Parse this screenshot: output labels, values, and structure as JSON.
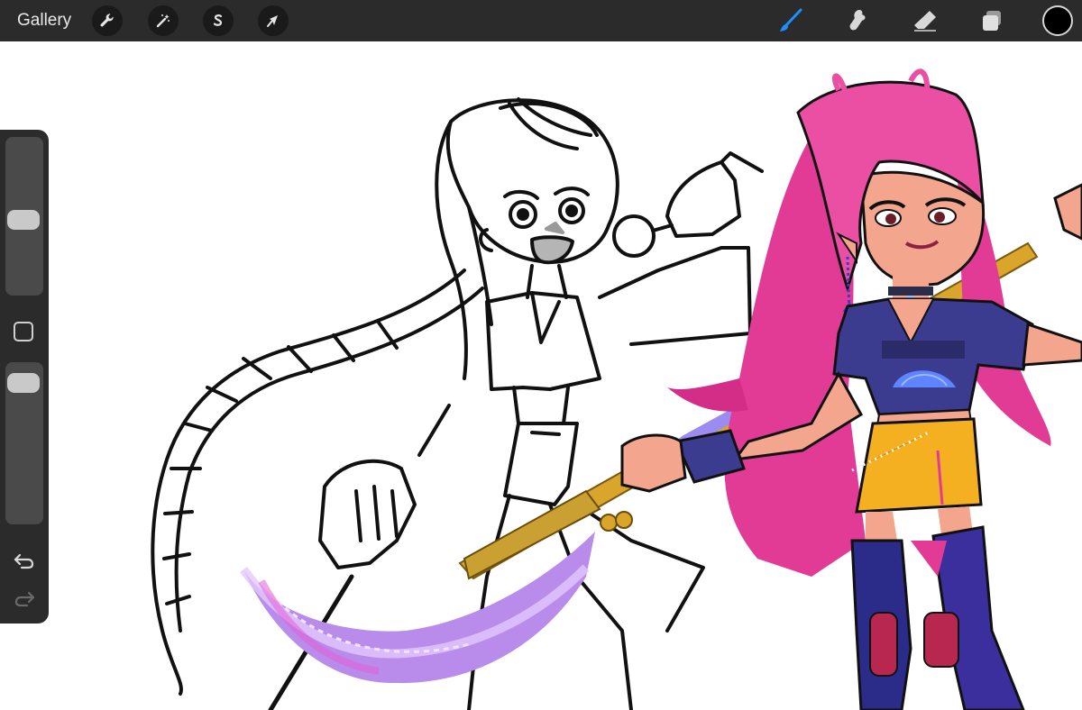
{
  "topbar": {
    "gallery_label": "Gallery",
    "left_tools": [
      "wrench-icon",
      "magic-wand-icon",
      "selection-icon",
      "transform-arrow-icon"
    ],
    "right_tools": [
      "brush-icon",
      "smudge-icon",
      "eraser-icon",
      "layers-icon"
    ],
    "active_tool": "brush-icon",
    "active_color": "#000000",
    "accent": "#1f8fff"
  },
  "sidebar": {
    "size_slider_level": 0.47,
    "opacity_slider_level": 0.95,
    "actions": [
      "modify-button",
      "undo-icon",
      "redo-icon"
    ]
  },
  "canvas": {
    "description_colors": {
      "hair": "#e23b96",
      "skirt": "#f5b021",
      "top": "#3b3b8f",
      "blade": "#b57be8",
      "staff": "#d9a52b"
    }
  }
}
